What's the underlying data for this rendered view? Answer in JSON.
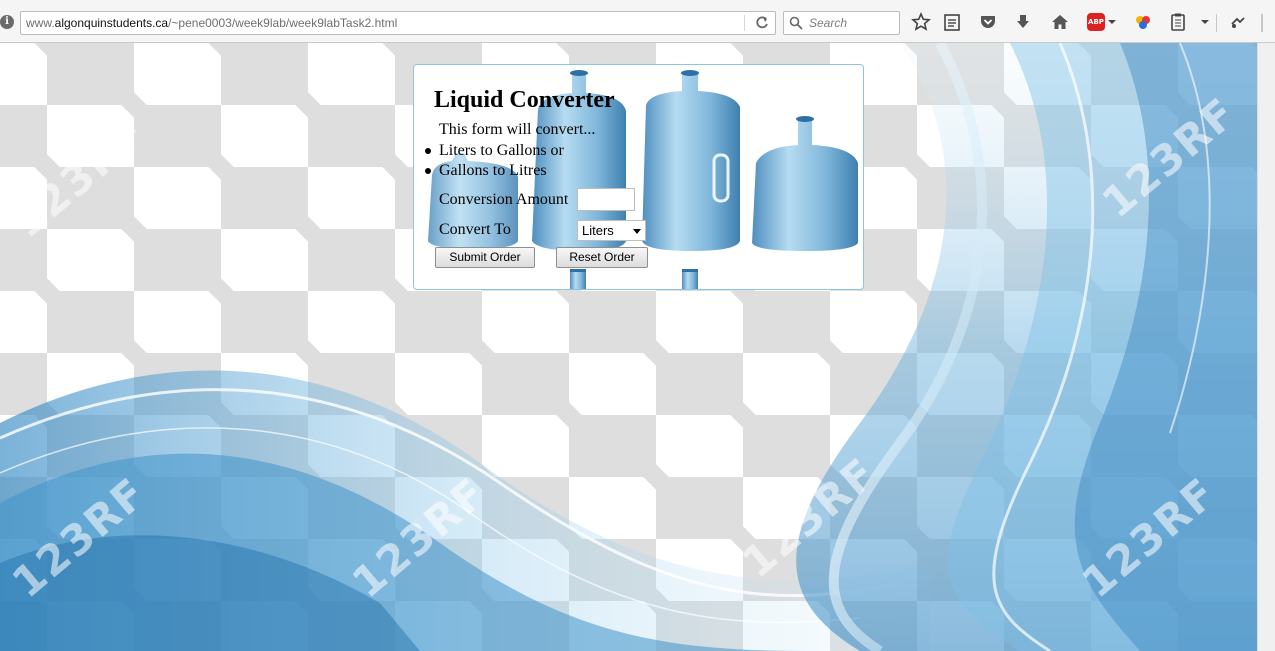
{
  "browser": {
    "url_prefix": "www.",
    "url_domain": "algonquinstudents.ca",
    "url_path": "/~pene0003/week9lab/week9labTask2.html",
    "search_placeholder": "Search",
    "icons": [
      "info-icon",
      "reload-icon",
      "search-icon",
      "bookmark-star-icon",
      "reading-list-icon",
      "pocket-icon",
      "download-icon",
      "home-icon",
      "adblock-icon",
      "extension-icon",
      "clipboard-icon",
      "menu-icon"
    ],
    "adblock_label": "ABP"
  },
  "background": {
    "colors": {
      "checker": "#dedede",
      "wave_light": "#bfe2f4",
      "wave_dark": "#3e8fc4"
    },
    "watermarks": [
      "123RF",
      "123RF",
      "123RF",
      "123RF",
      "123RF",
      "123RF"
    ]
  },
  "form": {
    "title": "Liquid Converter",
    "intro": "This form will convert...",
    "options": [
      "Liters to Gallons or",
      "Gallons to Litres"
    ],
    "amount_label": "Conversion Amount",
    "amount_value": "",
    "convert_label": "Convert To",
    "convert_selected": "Liters",
    "submit_label": "Submit Order",
    "reset_label": "Reset Order",
    "border_color": "#8fc5dc"
  }
}
